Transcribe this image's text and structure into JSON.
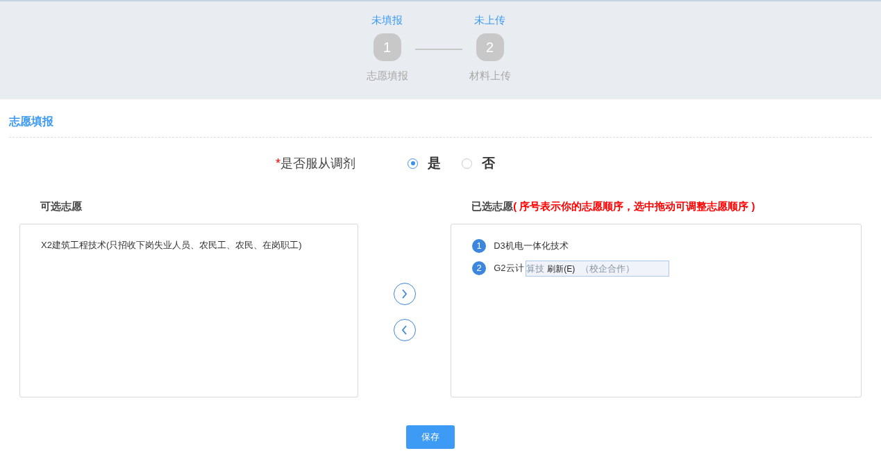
{
  "steps": [
    {
      "status": "未填报",
      "number": "1",
      "label": "志愿填报"
    },
    {
      "status": "未上传",
      "number": "2",
      "label": "材料上传"
    }
  ],
  "section_title": "志愿填报",
  "adjust": {
    "label": "是否服从调剂",
    "required_mark": "*",
    "options": [
      {
        "label": "是",
        "selected": true
      },
      {
        "label": "否",
        "selected": false
      }
    ]
  },
  "available": {
    "title": "可选志愿",
    "items": [
      "X2建筑工程技术(只招收下岗失业人员、农民工、农民、在岗职工)"
    ]
  },
  "move_buttons": [
    {
      "kind": "right"
    },
    {
      "kind": "left"
    }
  ],
  "chosen": {
    "title": "已选志愿",
    "note": "( 序号表示你的志愿顺序，选中拖动可调整志愿顺序 )",
    "items": [
      {
        "number": "1",
        "name": "D3机电一体化技术"
      },
      {
        "number": "2",
        "name": "G2云计"
      }
    ]
  },
  "tooltip": {
    "behind_left": "算技",
    "label": "刷新(E)",
    "behind_right": "（校企合作）"
  },
  "save_button": "保存"
}
